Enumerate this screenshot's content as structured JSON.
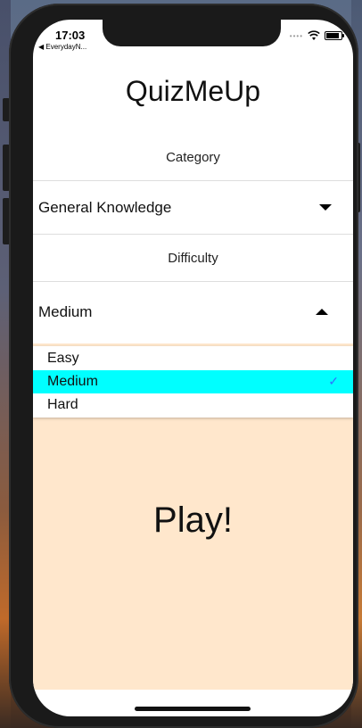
{
  "status": {
    "time": "17:03",
    "back_label": "◀ EverydayN..."
  },
  "app": {
    "title": "QuizMeUp"
  },
  "category": {
    "label": "Category",
    "selected": "General Knowledge"
  },
  "difficulty": {
    "label": "Difficulty",
    "selected": "Medium",
    "options": [
      "Easy",
      "Medium",
      "Hard"
    ],
    "selected_index": 1
  },
  "play": {
    "label": "Play!"
  },
  "colors": {
    "play_bg": "#ffe7cc",
    "selected_option_bg": "#00ffff",
    "check_color": "#2f6fff"
  }
}
